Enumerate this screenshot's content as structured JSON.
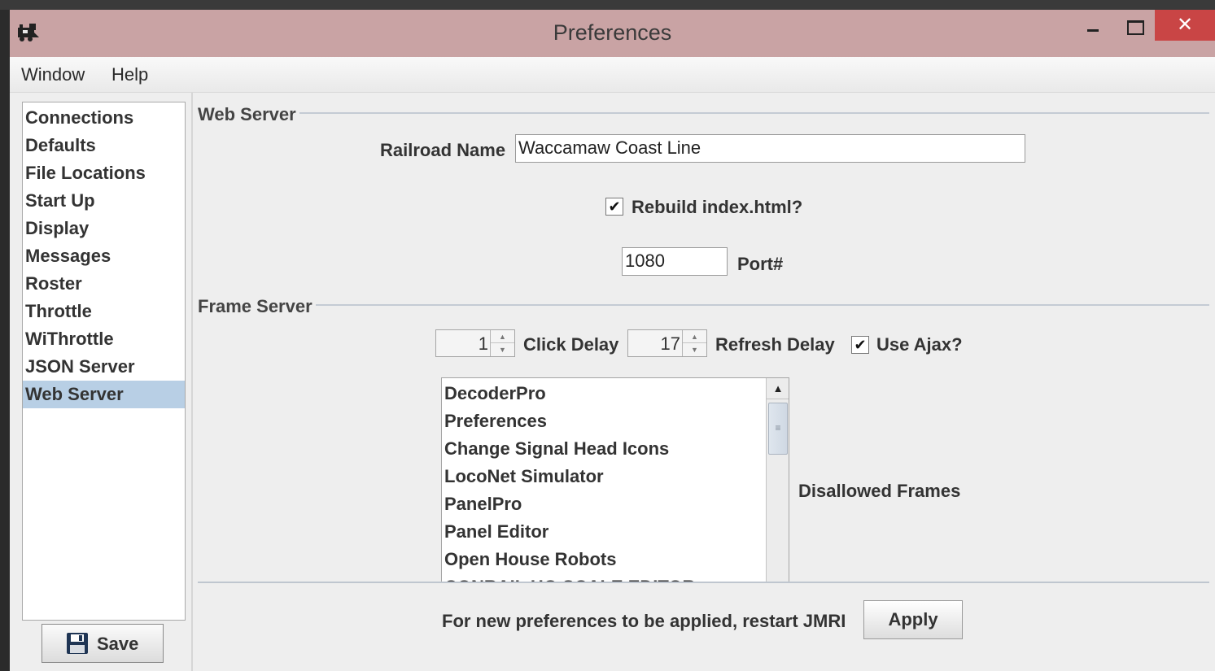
{
  "window": {
    "title": "Preferences",
    "close_glyph": "✕"
  },
  "menubar": {
    "items": [
      "Window",
      "Help"
    ]
  },
  "sidebar": {
    "items": [
      {
        "label": "Connections",
        "selected": false
      },
      {
        "label": "Defaults",
        "selected": false
      },
      {
        "label": "File Locations",
        "selected": false
      },
      {
        "label": "Start Up",
        "selected": false
      },
      {
        "label": "Display",
        "selected": false
      },
      {
        "label": "Messages",
        "selected": false
      },
      {
        "label": "Roster",
        "selected": false
      },
      {
        "label": "Throttle",
        "selected": false
      },
      {
        "label": "WiThrottle",
        "selected": false
      },
      {
        "label": "JSON Server",
        "selected": false
      },
      {
        "label": "Web Server",
        "selected": true
      }
    ],
    "save_label": "Save",
    "save_icon": "floppy-disk-icon"
  },
  "web_server": {
    "section_title": "Web Server",
    "railroad_label": "Railroad Name",
    "railroad_value": "Waccamaw Coast Line",
    "rebuild_label": "Rebuild index.html?",
    "rebuild_checked": true,
    "port_value": "1080",
    "port_label": "Port#"
  },
  "frame_server": {
    "section_title": "Frame Server",
    "click_delay_value": "1",
    "click_delay_label": "Click Delay",
    "refresh_delay_value": "17",
    "refresh_delay_label": "Refresh Delay",
    "use_ajax_label": "Use Ajax?",
    "use_ajax_checked": true,
    "frames": [
      "DecoderPro",
      "Preferences",
      "Change Signal Head Icons",
      "LocoNet Simulator",
      "PanelPro",
      "Panel Editor",
      "Open House Robots",
      "CONRAIL HO SCALE EDITOR"
    ],
    "disallowed_label": "Disallowed Frames"
  },
  "footer": {
    "restart_note": "For new preferences to be applied, restart JMRI",
    "apply_label": "Apply"
  },
  "colors": {
    "titlebar": "#c9a3a4",
    "close_button": "#c94545",
    "selection": "#b8cfe5"
  }
}
